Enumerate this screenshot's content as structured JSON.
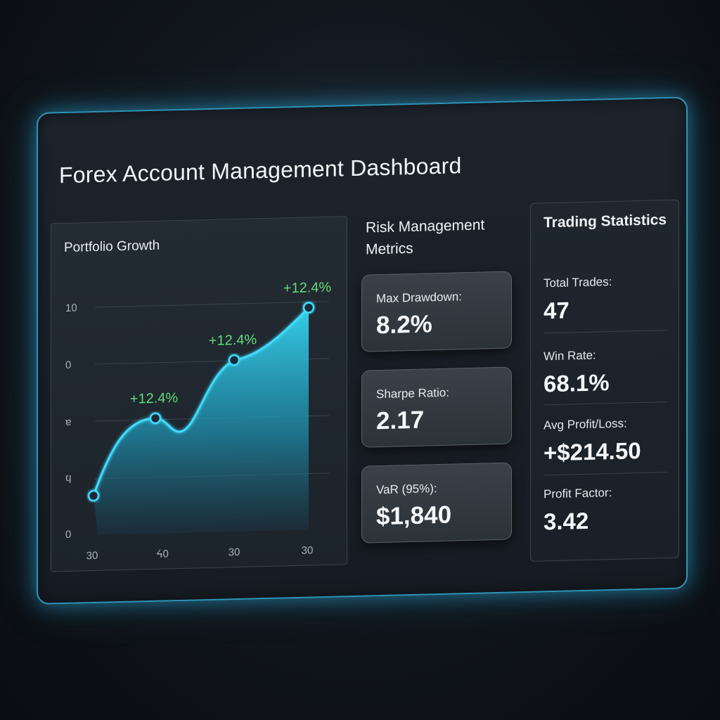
{
  "dashboard": {
    "title": "Forex Account Management Dashboard"
  },
  "portfolio_growth": {
    "title": "Portfolio Growth",
    "point_labels": [
      "+12.4%",
      "+12.4%",
      "+12.4%"
    ]
  },
  "chart_data": {
    "type": "area",
    "title": "Portfolio Growth",
    "y_tick_labels": [
      "10",
      "0",
      "ɐ",
      "ϥ",
      "0"
    ],
    "x_tick_labels": [
      "30",
      "ᔦ0",
      "30",
      "30"
    ],
    "x": [
      "30",
      "ᔦ0",
      "30",
      "30"
    ],
    "values": [
      1.3,
      4.0,
      6.0,
      7.8
    ],
    "annotations": [
      "+12.4%",
      "+12.4%",
      "+12.4%"
    ],
    "grid": true,
    "colors": {
      "line": "#3fdcff",
      "fill_top": "#2ec9e6",
      "fill_bottom": "#1b3340",
      "annotation": "#5fdc7a"
    }
  },
  "risk": {
    "title": "Risk Management Metrics",
    "cards": [
      {
        "label": "Max Drawdown:",
        "value": "8.2%"
      },
      {
        "label": "Sharpe Ratio:",
        "value": "2.17"
      },
      {
        "label": "VaR (95%):",
        "value": "$1,840"
      }
    ]
  },
  "trading": {
    "title": "Trading Statistics",
    "stats": [
      {
        "label": "Total Trades:",
        "value": "47"
      },
      {
        "label": "Win Rate:",
        "value": "68.1%"
      },
      {
        "label": "Avg Profit/Loss:",
        "value": "+$214.50"
      },
      {
        "label": "Profit Factor:",
        "value": "3.42"
      }
    ]
  },
  "colors": {
    "accent_glow": "#2e93b8",
    "positive": "#5fdc7a"
  }
}
